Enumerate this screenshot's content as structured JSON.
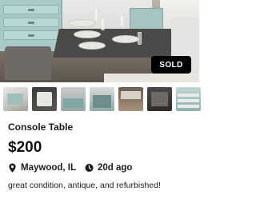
{
  "listing": {
    "status_badge": "SOLD",
    "title": "Console Table",
    "price": "$200",
    "location": "Maywood, IL",
    "posted_age": "20d ago",
    "description": "great condition, antique, and refurbished!"
  },
  "gallery": {
    "thumbnail_count": 7
  },
  "icons": {
    "location": "map-marker-icon",
    "time": "clock-icon"
  },
  "colors": {
    "badge_background": "#000000",
    "badge_text": "#ffffff",
    "text": "#1c1c1c"
  }
}
